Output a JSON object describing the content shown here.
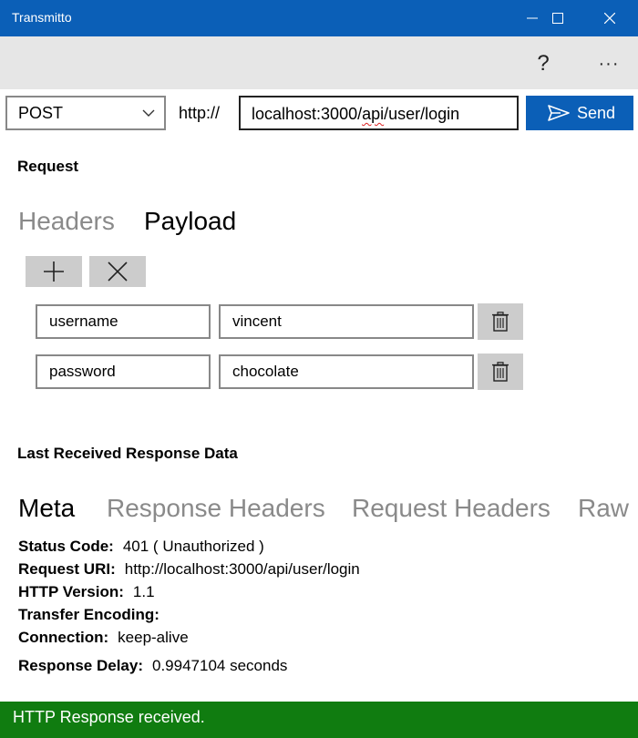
{
  "window": {
    "title": "Transmitto",
    "controls": {
      "minimize": "minimize-icon",
      "maximize": "maximize-icon",
      "close": "close-icon"
    }
  },
  "commandbar": {
    "help_label": "?",
    "more_label": "···"
  },
  "request_bar": {
    "method": "POST",
    "protocol": "http://",
    "url_prefix": "localhost:3000/",
    "url_misspelled": "api",
    "url_suffix": "/user/login",
    "send_label": "Send"
  },
  "request": {
    "section_title": "Request",
    "tabs": [
      {
        "label": "Headers",
        "active": false
      },
      {
        "label": "Payload",
        "active": true
      }
    ],
    "add_icon": "plus-icon",
    "clear_icon": "x-icon",
    "payload": [
      {
        "key": "username",
        "value": "vincent"
      },
      {
        "key": "password",
        "value": "chocolate"
      }
    ]
  },
  "response": {
    "section_title": "Last Received Response Data",
    "tabs": [
      {
        "label": "Meta",
        "active": true
      },
      {
        "label": "Response Headers",
        "active": false
      },
      {
        "label": "Request Headers",
        "active": false
      },
      {
        "label": "Raw",
        "active": false
      }
    ],
    "meta": [
      {
        "key": "Status Code:",
        "value": "401 ( Unauthorized )"
      },
      {
        "key": "Request URI:",
        "value": "http://localhost:3000/api/user/login"
      },
      {
        "key": "HTTP Version:",
        "value": "1.1"
      },
      {
        "key": "Transfer Encoding:",
        "value": ""
      },
      {
        "key": "Connection:",
        "value": "keep-alive"
      },
      {
        "key": "Response Delay:",
        "value": "0.9947104 seconds"
      }
    ]
  },
  "status": {
    "text": "HTTP Response received.",
    "color": "#107c10"
  },
  "colors": {
    "accent": "#0b5fb7",
    "status_ok": "#107c10"
  }
}
